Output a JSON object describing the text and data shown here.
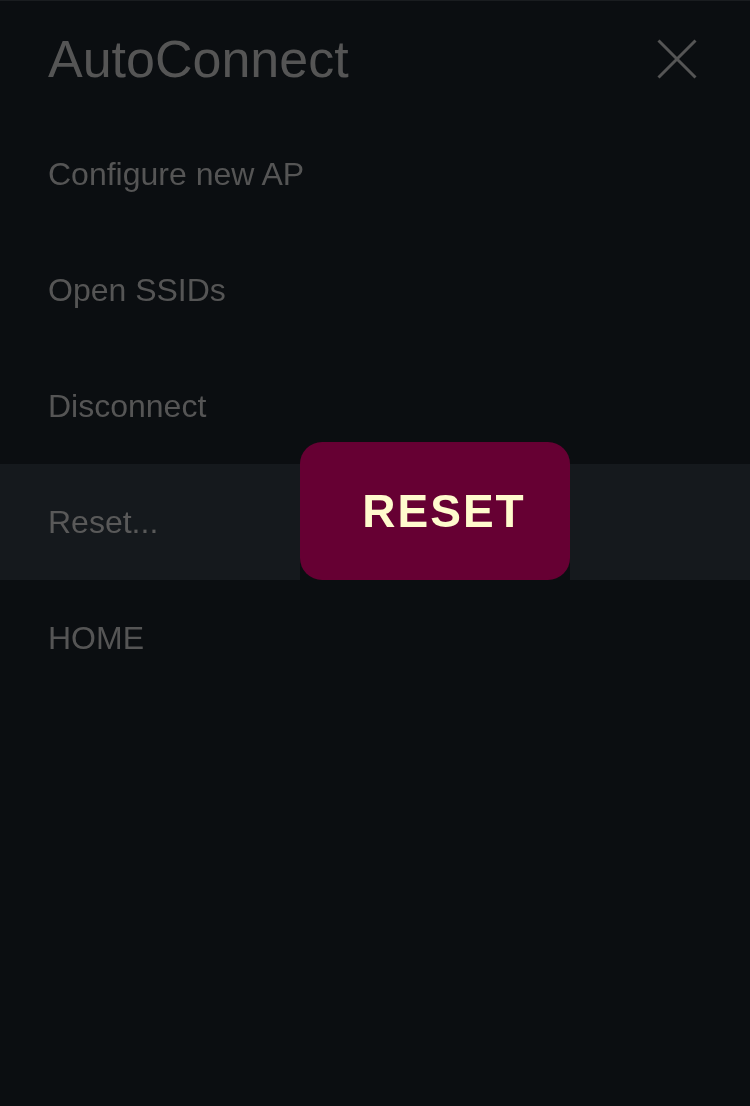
{
  "header": {
    "title": "AutoConnect"
  },
  "menu": [
    {
      "label": "Configure new AP",
      "selected": false
    },
    {
      "label": "Open SSIDs",
      "selected": false
    },
    {
      "label": "Disconnect",
      "selected": false
    },
    {
      "label": "Reset...",
      "selected": true,
      "popup": {
        "label": "RESET"
      }
    },
    {
      "label": "HOME",
      "selected": false
    }
  ]
}
